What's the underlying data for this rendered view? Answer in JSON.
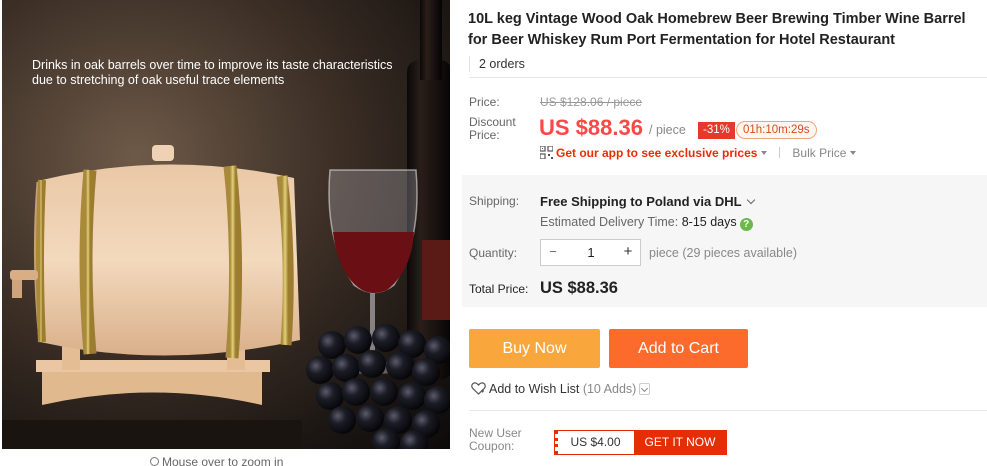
{
  "gallery": {
    "caption": "Drinks in oak barrels over time to improve its taste characteristics due to stretching of oak useful trace elements",
    "zoom_hint": "Mouse over to zoom in"
  },
  "product": {
    "title": "10L keg Vintage Wood Oak Homebrew Beer Brewing Timber Wine Barrel for Beer Whiskey Rum Port Fermentation for Hotel Restaurant",
    "orders": "2 orders"
  },
  "pricing": {
    "price_label": "Price:",
    "original_price": "US $128.06 / piece",
    "discount_label": "Discount Price:",
    "discount_price": "US $88.36",
    "per_piece": "/ piece",
    "discount_badge": "-31%",
    "countdown": "01h:10m:29s",
    "app_link": "Get our app to see exclusive prices",
    "bulk_price": "Bulk Price"
  },
  "shipping": {
    "label": "Shipping:",
    "free_text": "Free Shipping to",
    "destination": "Poland via DHL",
    "delivery_label": "Estimated Delivery Time:",
    "delivery_days": "8-15 days"
  },
  "quantity": {
    "label": "Quantity:",
    "value": "1",
    "minus": "−",
    "plus": "+",
    "available": "piece (29 pieces available)"
  },
  "total": {
    "label": "Total Price:",
    "value": "US $88.36"
  },
  "actions": {
    "buy_now": "Buy Now",
    "add_to_cart": "Add to Cart",
    "wish_list": "Add to Wish List",
    "wish_count": "(10 Adds)"
  },
  "coupon": {
    "label": "New User Coupon:",
    "amount": "US $4.00",
    "get_label": "GET IT NOW"
  },
  "colors": {
    "accent_red": "#ff4747",
    "buy_now": "#f9a73c",
    "add_to_cart": "#fd6b2c",
    "coupon_red": "#e62e04"
  }
}
